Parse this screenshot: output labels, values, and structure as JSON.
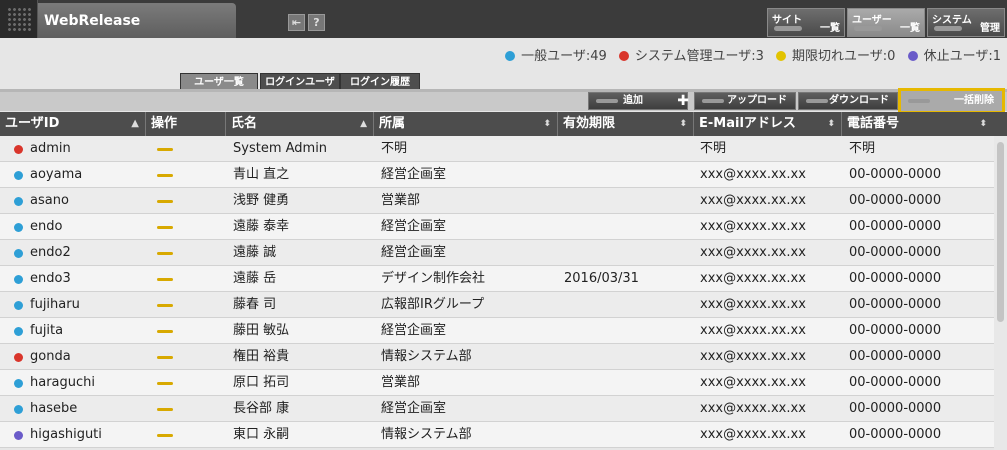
{
  "app": {
    "title": "WebRelease"
  },
  "nav": [
    {
      "line1": "サイト",
      "line2": "一覧"
    },
    {
      "line1": "ユーザー",
      "line2": "一覧"
    },
    {
      "line1": "システム",
      "line2": "管理"
    }
  ],
  "legend": [
    {
      "label": "一般ユーザ:49",
      "color": "#2e9fd6"
    },
    {
      "label": "システム管理ユーザ:3",
      "color": "#d9352b"
    },
    {
      "label": "期限切れユーザ:0",
      "color": "#e2c300"
    },
    {
      "label": "休止ユーザ:1",
      "color": "#6a5bc9"
    }
  ],
  "tabs": [
    "ユーザ一覧",
    "ログインユーザ",
    "ログイン履歴"
  ],
  "actions": {
    "add": "追加",
    "upload": "アップロード",
    "download": "ダウンロード",
    "bulk_delete": "一括削除"
  },
  "columns": [
    "ユーザID",
    "操作",
    "氏名",
    "所属",
    "有効期限",
    "E-Mailアドレス",
    "電話番号"
  ],
  "colors": {
    "user": "#2e9fd6",
    "admin": "#d9352b",
    "suspended": "#6a5bc9",
    "op": "#d8a900"
  },
  "rows": [
    {
      "id": "admin",
      "type": "admin",
      "name": "System Admin",
      "dept": "不明",
      "expiry": "",
      "email": "不明",
      "phone": "不明"
    },
    {
      "id": "aoyama",
      "type": "user",
      "name": "青山 直之",
      "dept": "経営企画室",
      "expiry": "",
      "email": "xxx@xxxx.xx.xx",
      "phone": "00-0000-0000"
    },
    {
      "id": "asano",
      "type": "user",
      "name": "浅野 健勇",
      "dept": "営業部",
      "expiry": "",
      "email": "xxx@xxxx.xx.xx",
      "phone": "00-0000-0000"
    },
    {
      "id": "endo",
      "type": "user",
      "name": "遠藤 泰幸",
      "dept": "経営企画室",
      "expiry": "",
      "email": "xxx@xxxx.xx.xx",
      "phone": "00-0000-0000"
    },
    {
      "id": "endo2",
      "type": "user",
      "name": "遠藤 誠",
      "dept": "経営企画室",
      "expiry": "",
      "email": "xxx@xxxx.xx.xx",
      "phone": "00-0000-0000"
    },
    {
      "id": "endo3",
      "type": "user",
      "name": "遠藤 岳",
      "dept": "デザイン制作会社",
      "expiry": "2016/03/31",
      "email": "xxx@xxxx.xx.xx",
      "phone": "00-0000-0000"
    },
    {
      "id": "fujiharu",
      "type": "user",
      "name": "藤春 司",
      "dept": "広報部IRグループ",
      "expiry": "",
      "email": "xxx@xxxx.xx.xx",
      "phone": "00-0000-0000"
    },
    {
      "id": "fujita",
      "type": "user",
      "name": "藤田 敏弘",
      "dept": "経営企画室",
      "expiry": "",
      "email": "xxx@xxxx.xx.xx",
      "phone": "00-0000-0000"
    },
    {
      "id": "gonda",
      "type": "admin",
      "name": "権田 裕貴",
      "dept": "情報システム部",
      "expiry": "",
      "email": "xxx@xxxx.xx.xx",
      "phone": "00-0000-0000"
    },
    {
      "id": "haraguchi",
      "type": "user",
      "name": "原口 拓司",
      "dept": "営業部",
      "expiry": "",
      "email": "xxx@xxxx.xx.xx",
      "phone": "00-0000-0000"
    },
    {
      "id": "hasebe",
      "type": "user",
      "name": "長谷部 康",
      "dept": "経営企画室",
      "expiry": "",
      "email": "xxx@xxxx.xx.xx",
      "phone": "00-0000-0000"
    },
    {
      "id": "higashiguti",
      "type": "suspended",
      "name": "東口 永嗣",
      "dept": "情報システム部",
      "expiry": "",
      "email": "xxx@xxxx.xx.xx",
      "phone": "00-0000-0000"
    }
  ]
}
